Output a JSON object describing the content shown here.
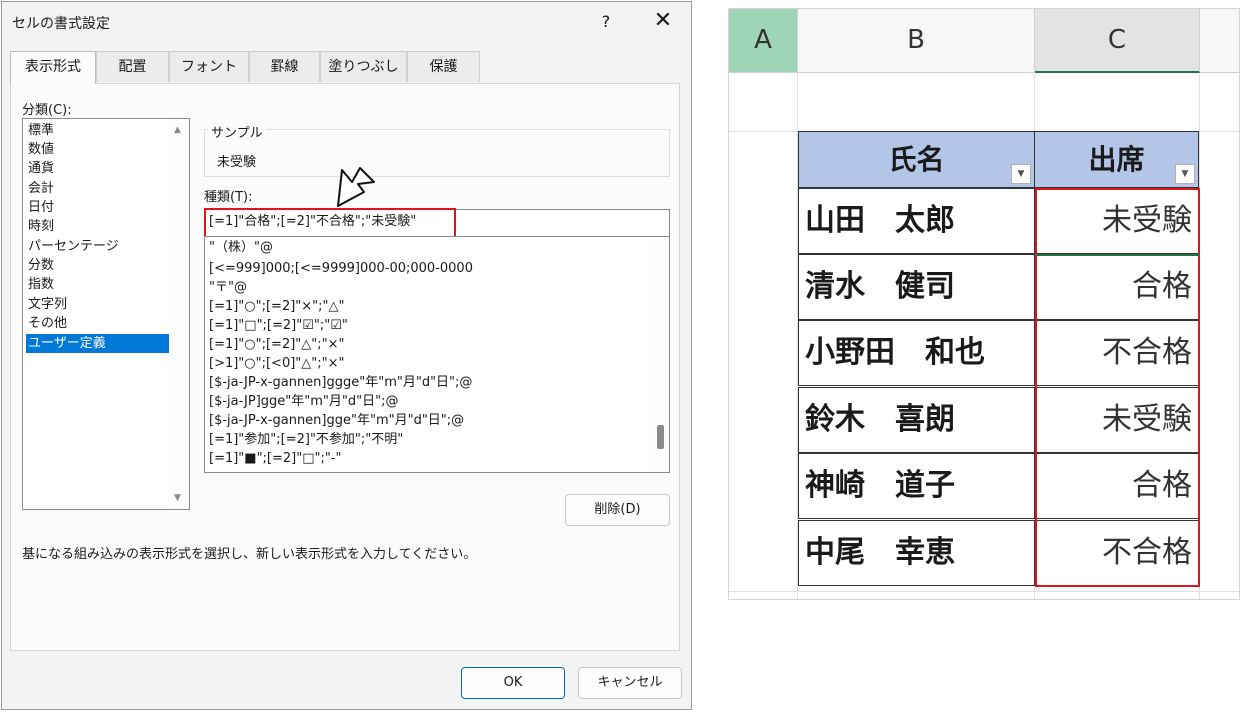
{
  "dialog": {
    "title": "セルの書式設定",
    "help": "?",
    "close": "✕",
    "tabs": [
      {
        "label": "表示形式"
      },
      {
        "label": "配置"
      },
      {
        "label": "フォント"
      },
      {
        "label": "罫線"
      },
      {
        "label": "塗りつぶし"
      },
      {
        "label": "保護"
      }
    ],
    "category_label": "分類(C):",
    "categories": [
      {
        "label": "標準"
      },
      {
        "label": "数値"
      },
      {
        "label": "通貨"
      },
      {
        "label": "会計"
      },
      {
        "label": "日付"
      },
      {
        "label": "時刻"
      },
      {
        "label": "パーセンテージ"
      },
      {
        "label": "分数"
      },
      {
        "label": "指数"
      },
      {
        "label": "文字列"
      },
      {
        "label": "その他"
      },
      {
        "label": "ユーザー定義"
      }
    ],
    "selected_category": "ユーザー定義",
    "sample_label": "サンプル",
    "sample_value": "未受験",
    "type_label": "種類(T):",
    "type_value": "[=1]\"合格\";[=2]\"不合格\";\"未受験\"",
    "type_list": [
      {
        "label": "\"（株）\"@"
      },
      {
        "label": "[<=999]000;[<=9999]000-00;000-0000"
      },
      {
        "label": "\"〒\"@"
      },
      {
        "label": "[=1]\"○\";[=2]\"×\";\"△\""
      },
      {
        "label": "[=1]\"□\";[=2]\"☑\";\"☑\""
      },
      {
        "label": "[=1]\"○\";[=2]\"△\";\"×\""
      },
      {
        "label": "[>1]\"○\";[<0]\"△\";\"×\""
      },
      {
        "label": "[$-ja-JP-x-gannen]ggge\"年\"m\"月\"d\"日\";@"
      },
      {
        "label": "[$-ja-JP]gge\"年\"m\"月\"d\"日\";@"
      },
      {
        "label": "[$-ja-JP-x-gannen]gge\"年\"m\"月\"d\"日\";@"
      },
      {
        "label": "[=1]\"参加\";[=2]\"不参加\";\"不明\""
      },
      {
        "label": "[=1]\"■\";[=2]\"□\";\"-\""
      }
    ],
    "delete_button": "削除(D)",
    "description": "基になる組み込みの表示形式を選択し、新しい表示形式を入力してください。",
    "ok_button": "OK",
    "cancel_button": "キャンセル"
  },
  "sheet": {
    "columns": [
      "A",
      "B",
      "C"
    ],
    "headers": {
      "name": "氏名",
      "attendance": "出席"
    },
    "rows": [
      {
        "name": "山田　太郎",
        "attendance": "未受験"
      },
      {
        "name": "清水　健司",
        "attendance": "合格"
      },
      {
        "name": "小野田　和也",
        "attendance": "不合格"
      },
      {
        "name": "鈴木　喜朗",
        "attendance": "未受験"
      },
      {
        "name": "神崎　道子",
        "attendance": "合格"
      },
      {
        "name": "中尾　幸恵",
        "attendance": "不合格"
      }
    ]
  },
  "colors": {
    "highlight": "#e0141e",
    "selected": "#0078d7",
    "header_fill": "#b4c6e7",
    "excel_green": "#217346"
  }
}
